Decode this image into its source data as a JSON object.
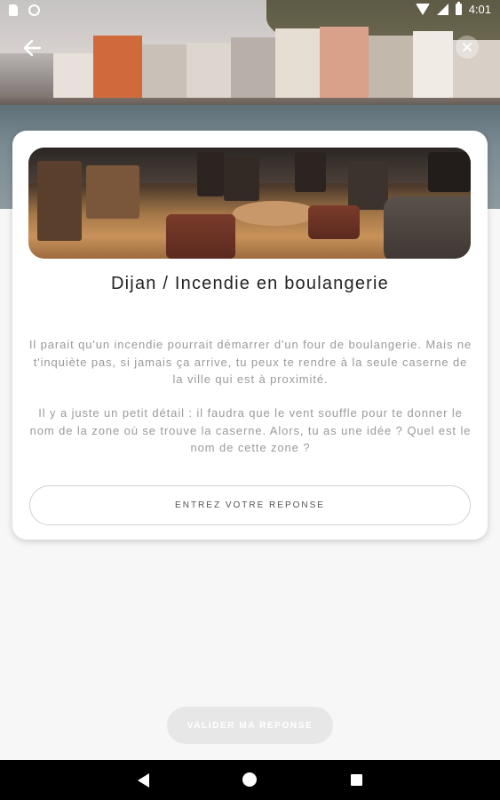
{
  "status_bar": {
    "time": "4:01"
  },
  "hero": {
    "back_icon": "arrow-left-icon",
    "close_icon": "close-icon"
  },
  "card": {
    "title": "Dijan / Incendie en boulangerie",
    "paragraph_1": "Il parait qu'un incendie pourrait démarrer d'un four de boulangerie. Mais ne t'inquiète pas, si jamais ça arrive, tu peux te rendre à la seule caserne de la ville qui est à proximité.",
    "paragraph_2": "Il y a juste un petit détail : il faudra que le vent souffle pour te donner le nom de la zone où se trouve la caserne. Alors, tu as une idée ? Quel est le nom de cette zone ?",
    "answer_placeholder": "ENTREZ VOTRE REPONSE",
    "answer_value": ""
  },
  "validate_label": "VALIDER MA REPONSE",
  "nav": {
    "back": "nav-back-icon",
    "home": "nav-home-icon",
    "recent": "nav-recent-icon"
  }
}
